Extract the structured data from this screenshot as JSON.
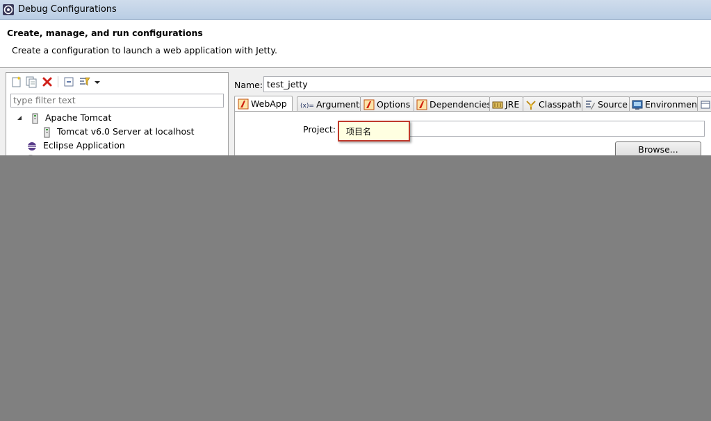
{
  "window": {
    "title": "Debug Configurations"
  },
  "header": {
    "title": "Create, manage, and run configurations",
    "description": "Create a configuration to launch a web application with Jetty."
  },
  "sidebar": {
    "filter_placeholder": "type filter text",
    "tree": [
      {
        "label": "Apache Tomcat",
        "icon": "server-icon",
        "expanded": true
      },
      {
        "label": "Tomcat v6.0 Server at localhost",
        "icon": "server-icon"
      },
      {
        "label": "Eclipse Application",
        "icon": "eclipse-icon"
      }
    ]
  },
  "config": {
    "name_label": "Name:",
    "name_value": "test_jetty",
    "tabs": [
      {
        "label": "WebApp",
        "icon": "jetty-icon",
        "active": true
      },
      {
        "label": "Arguments",
        "icon": "arguments-icon"
      },
      {
        "label": "Options",
        "icon": "jetty-icon"
      },
      {
        "label": "Dependencies",
        "icon": "jetty-icon"
      },
      {
        "label": "JRE",
        "icon": "jre-icon"
      },
      {
        "label": "Classpath",
        "icon": "classpath-icon"
      },
      {
        "label": "Source",
        "icon": "source-icon"
      },
      {
        "label": "Environment",
        "icon": "environment-icon"
      }
    ],
    "project_label": "Project:",
    "project_value": "",
    "browse_label": "Browse...",
    "tooltip": "项目名"
  },
  "colors": {
    "annotation_border": "#c0392b",
    "tooltip_bg": "#ffffe1",
    "cover": "#808080"
  }
}
